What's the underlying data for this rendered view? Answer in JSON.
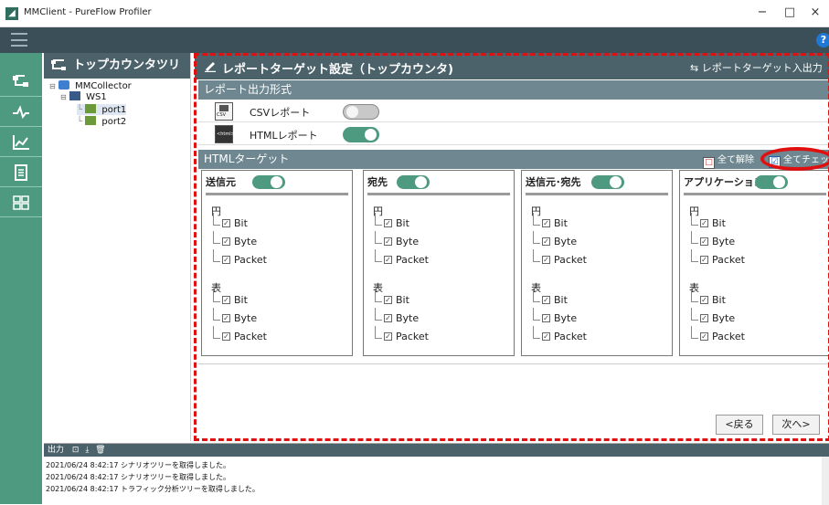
{
  "window": {
    "title": "MMClient - PureFlow Profiler",
    "minimize": "−",
    "maximize": "□",
    "close": "×"
  },
  "menubar": {
    "help": "?"
  },
  "tree": {
    "title": "トップカウンタツリー",
    "nodes": [
      {
        "label": "MMCollector",
        "icon": "collector-icon"
      },
      {
        "label": "WS1",
        "icon": "device-icon"
      },
      {
        "label": "port1",
        "icon": "port-icon"
      },
      {
        "label": "port2",
        "icon": "port-icon"
      }
    ]
  },
  "main": {
    "title": "レポートターゲット設定（トップカウンタ)",
    "io_link": "レポートターゲット入出力",
    "format_section": "レポート出力形式",
    "formats": [
      {
        "label": "CSVレポート",
        "enabled": false,
        "icon": "csv-file-icon",
        "icon_text": "CSV"
      },
      {
        "label": "HTMLレポート",
        "enabled": true,
        "icon": "html-file-icon",
        "icon_text": "<html>"
      }
    ],
    "target_section": "HTMLターゲット",
    "uncheck_all": "全て解除",
    "check_all": "全てチェック",
    "cards": [
      {
        "title": "送信元",
        "enabled": true
      },
      {
        "title": "宛先",
        "enabled": true
      },
      {
        "title": "送信元･宛先",
        "enabled": true
      },
      {
        "title": "アプリケーション",
        "enabled": true
      }
    ],
    "groups": [
      {
        "label": "円",
        "items": [
          "Bit",
          "Byte",
          "Packet"
        ]
      },
      {
        "label": "表",
        "items": [
          "Bit",
          "Byte",
          "Packet"
        ]
      }
    ],
    "back_button": "<戻る",
    "next_button": "次へ>"
  },
  "output": {
    "title": "出力",
    "logs": [
      "2021/06/24 8:42:17 シナリオツリーを取得しました。",
      "2021/06/24 8:42:17 シナリオツリーを取得しました。",
      "2021/06/24 8:42:17 トラフィック分析ツリーを取得しました。"
    ]
  },
  "colors": {
    "nav": "#4d9a80",
    "header": "#4b626b",
    "section": "#6e8790",
    "highlight": "#e01010"
  }
}
